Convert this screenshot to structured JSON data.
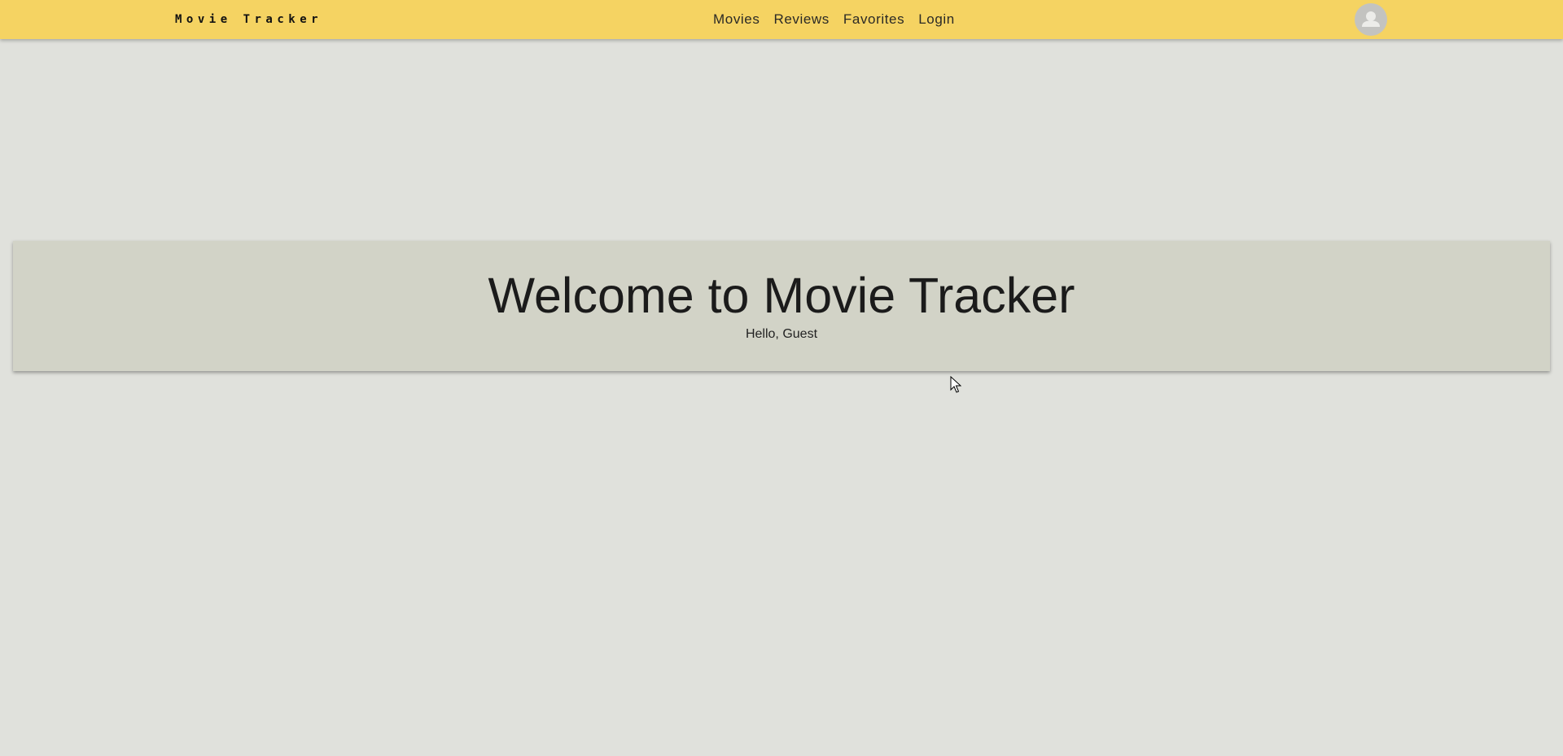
{
  "navbar": {
    "brand": "Movie Tracker",
    "links": [
      {
        "label": "Movies"
      },
      {
        "label": "Reviews"
      },
      {
        "label": "Favorites"
      },
      {
        "label": "Login"
      }
    ],
    "avatar_icon": "user-avatar-icon"
  },
  "hero": {
    "title": "Welcome to Movie Tracker",
    "subtitle": "Hello, Guest"
  },
  "colors": {
    "navbar_bg": "#f5d362",
    "page_bg": "#e0e1dc",
    "hero_bg": "#d2d3c7"
  }
}
